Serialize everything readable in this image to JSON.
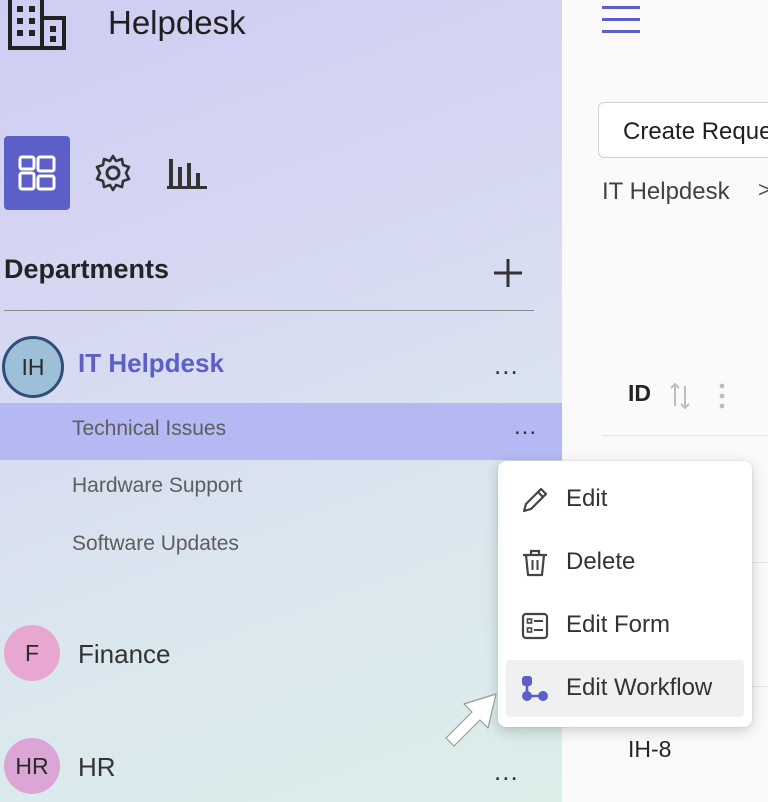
{
  "app": {
    "title": "Helpdesk"
  },
  "nav_tabs": [
    {
      "icon": "dashboard-icon",
      "active": true
    },
    {
      "icon": "gear-icon",
      "active": false
    },
    {
      "icon": "bar-chart-icon",
      "active": false
    }
  ],
  "sidebar": {
    "section_title": "Departments",
    "add_icon": "plus-icon",
    "departments": [
      {
        "initials": "IH",
        "name": "IT Helpdesk",
        "avatar_color": "#9dbfd8",
        "active": true,
        "sub_items": [
          {
            "label": "Technical Issues",
            "active": true
          },
          {
            "label": "Hardware Support",
            "active": false
          },
          {
            "label": "Software Updates",
            "active": false
          }
        ]
      },
      {
        "initials": "F",
        "name": "Finance",
        "avatar_color": "#e8a7d0",
        "active": false
      },
      {
        "initials": "HR",
        "name": "HR",
        "avatar_color": "#dba6d6",
        "active": false
      }
    ],
    "more_label": "..."
  },
  "main": {
    "create_button": "Create Reque",
    "breadcrumb": "IT Helpdesk",
    "breadcrumb_separator": ">",
    "table": {
      "columns": [
        "ID"
      ],
      "rows": [
        {
          "id": "IH-8"
        }
      ]
    }
  },
  "context_menu": {
    "items": [
      {
        "label": "Edit",
        "icon": "pencil-icon"
      },
      {
        "label": "Delete",
        "icon": "trash-icon"
      },
      {
        "label": "Edit Form",
        "icon": "form-icon"
      },
      {
        "label": "Edit Workflow",
        "icon": "workflow-icon",
        "hovered": true
      }
    ]
  },
  "colors": {
    "accent": "#5b5fc7",
    "selected_row": "#b4b9f4",
    "dept_active_text": "#5b5fc7"
  }
}
